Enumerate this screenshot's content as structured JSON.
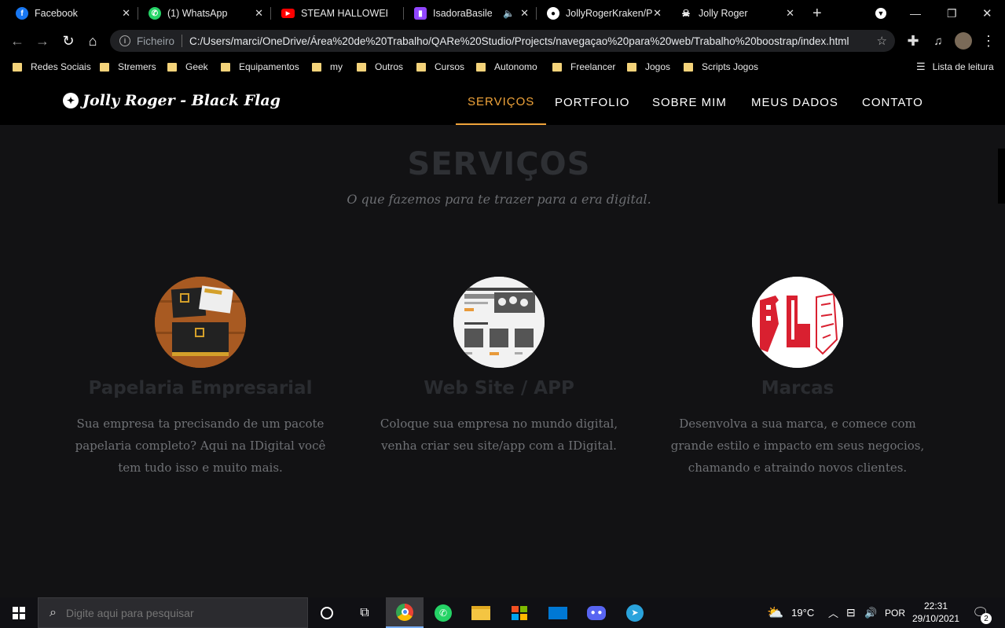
{
  "browser": {
    "tabs": [
      {
        "label": "Facebook",
        "icon": "facebook-icon",
        "color": "#1877f2"
      },
      {
        "label": "(1) WhatsApp",
        "icon": "whatsapp-icon",
        "color": "#25d366"
      },
      {
        "label": "STEAM HALLOWEEN",
        "icon": "youtube-icon",
        "color": "#ff0000"
      },
      {
        "label": "IsadoraBasile -",
        "icon": "twitch-icon",
        "color": "#9146ff"
      },
      {
        "label": "JollyRogerKraken/P",
        "icon": "github-icon",
        "color": "#ffffff"
      },
      {
        "label": "Jolly Roger",
        "icon": "jolly-roger-icon",
        "color": "#ffffff"
      }
    ],
    "address": {
      "scheme": "Ficheiro",
      "url": "C:/Users/marci/OneDrive/Área%20de%20Trabalho/QARe%20Studio/Projects/navegaçao%20para%20web/Trabalho%20boostrap/index.html"
    },
    "bookmarks": [
      "Redes Sociais",
      "Stremers",
      "Geek",
      "Equipamentos",
      "my",
      "Outros",
      "Cursos",
      "Autonomo",
      "Freelancer",
      "Jogos",
      "Scripts Jogos"
    ],
    "reading_list": "Lista de leitura"
  },
  "site": {
    "brand": "Jolly Roger - Black Flag",
    "nav": [
      "SERVIÇOS",
      "PORTFOLIO",
      "SOBRE MIM",
      "MEUS DADOS",
      "CONTATO"
    ],
    "section": {
      "title": "SERVIÇOS",
      "subtitle": "O que fazemos para te trazer para a era digital."
    },
    "services": [
      {
        "title": "Papelaria Empresarial",
        "text": "Sua empresa ta precisando de um pacote papelaria completo? Aqui na IDigital você tem tudo isso e muito mais."
      },
      {
        "title": "Web Site / APP",
        "text": "Coloque sua empresa no mundo digital, venha criar seu site/app com a IDigital."
      },
      {
        "title": "Marcas",
        "text": "Desenvolva a sua marca, e comece com grande estilo e impacto em seus negocios, chamando e atraindo novos clientes."
      }
    ],
    "colors": {
      "accent": "#f0a43a",
      "background": "#121214"
    }
  },
  "taskbar": {
    "search_placeholder": "Digite aqui para pesquisar",
    "weather": "19°C",
    "language": "POR",
    "time": "22:31",
    "date": "29/10/2021",
    "notifications": "2"
  }
}
